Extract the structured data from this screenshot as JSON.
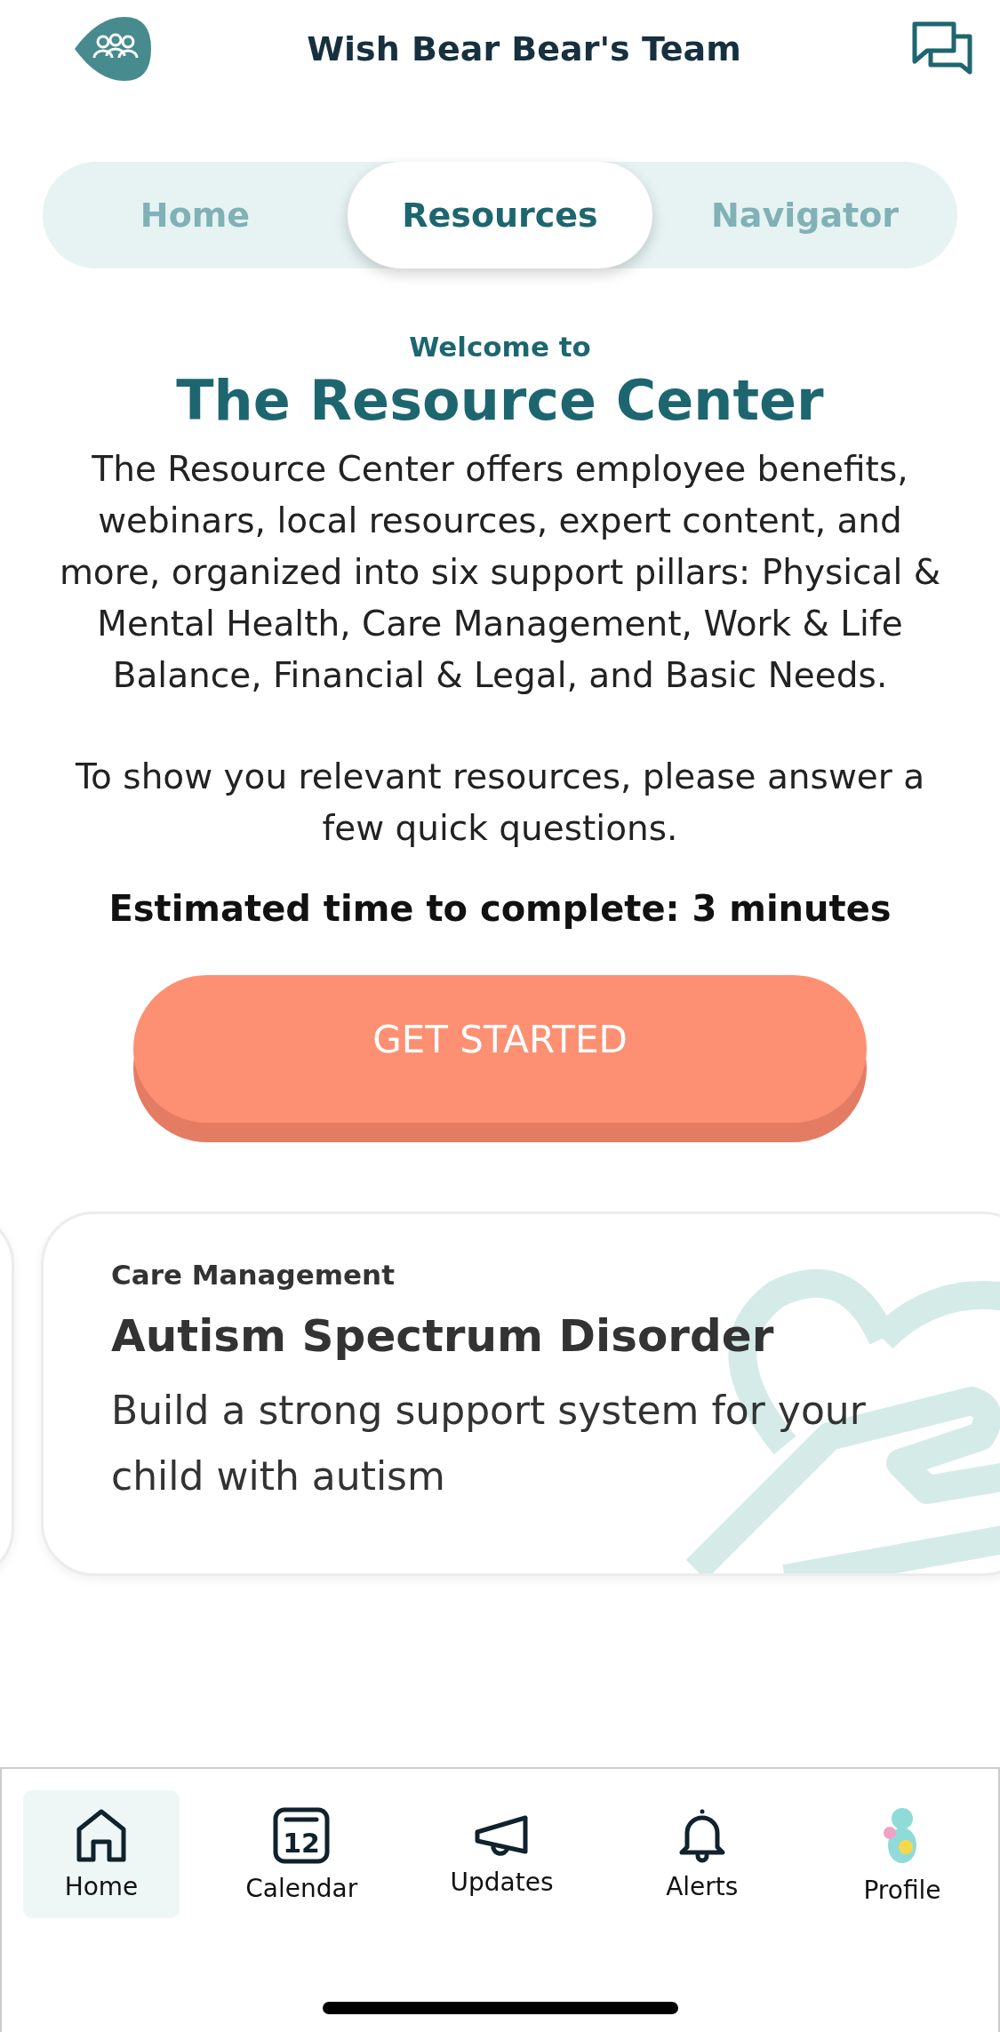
{
  "header": {
    "title": "Wish Bear Bear's Team"
  },
  "tabs": [
    {
      "label": "Home",
      "selected": false
    },
    {
      "label": "Resources",
      "selected": true
    },
    {
      "label": "Navigator",
      "selected": false
    }
  ],
  "intro": {
    "eyebrow": "Welcome to",
    "title": "The Resource Center",
    "paragraphs": [
      "The Resource Center offers employee benefits, webinars, local resources, expert content, and more, organized into six support pillars: Physical & Mental Health, Care Management, Work & Life Balance, Financial & Legal, and Basic Needs.",
      "To show you relevant resources, please answer a few quick questions."
    ],
    "estimate": "Estimated time to complete: 3 minutes",
    "button": "GET STARTED"
  },
  "cards": [
    {
      "category": "Care Management",
      "title": "Autism Spectrum Disorder",
      "description": "Build a strong support system for your child with autism"
    }
  ],
  "bottom_nav": [
    {
      "kind": "home",
      "label": "Home",
      "selected": true
    },
    {
      "kind": "calendar",
      "label": "Calendar",
      "selected": false,
      "icon_text": "12"
    },
    {
      "kind": "updates",
      "label": "Updates",
      "selected": false
    },
    {
      "kind": "alerts",
      "label": "Alerts",
      "selected": false
    },
    {
      "kind": "profile",
      "label": "Profile",
      "selected": false
    }
  ]
}
